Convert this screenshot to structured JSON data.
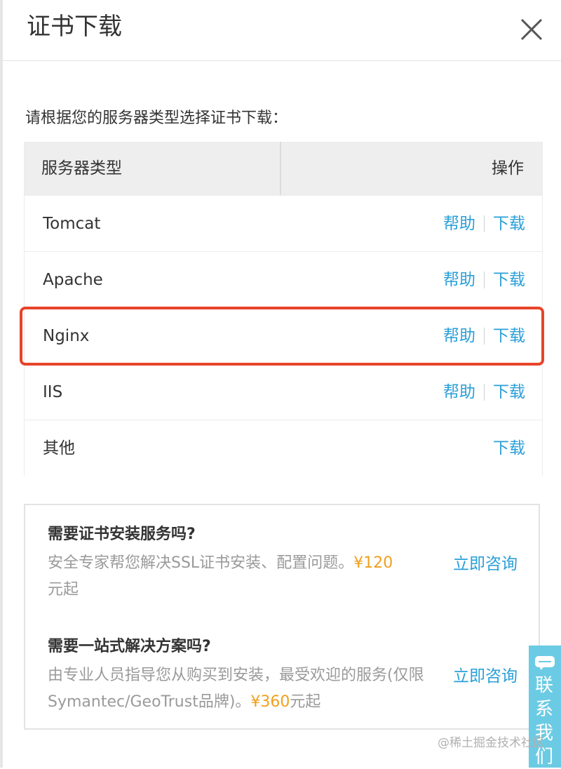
{
  "dialog": {
    "title": "证书下载"
  },
  "instruction": "请根据您的服务器类型选择证书下载：",
  "table": {
    "headers": {
      "type": "服务器类型",
      "action": "操作"
    },
    "rows": [
      {
        "name": "Tomcat",
        "help": "帮助",
        "download": "下载"
      },
      {
        "name": "Apache",
        "help": "帮助",
        "download": "下载"
      },
      {
        "name": "Nginx",
        "help": "帮助",
        "download": "下载",
        "highlighted": true
      },
      {
        "name": "IIS",
        "help": "帮助",
        "download": "下载"
      },
      {
        "name": "其他",
        "download": "下载"
      }
    ]
  },
  "promo": {
    "install": {
      "title": "需要证书安装服务吗?",
      "desc": "安全专家帮您解决SSL证书安装、配置问题。",
      "price": "¥120",
      "suffix": "元起",
      "consult": "立即咨询"
    },
    "solution": {
      "title": "需要一站式解决方案吗?",
      "desc": "由专业人员指导您从购买到安装，最受欢迎的服务(仅限Symantec/GeoTrust品牌)。",
      "price": "¥360",
      "suffix": "元起",
      "consult": "立即咨询"
    }
  },
  "contact": {
    "label": "联系我们",
    "icon": "chat-icon"
  },
  "watermark": "@稀土掘金技术社区",
  "colors": {
    "link": "#2a9fd8",
    "price": "#f0a020",
    "highlight": "#e8442a",
    "contact_tab": "#6ccbe4"
  }
}
